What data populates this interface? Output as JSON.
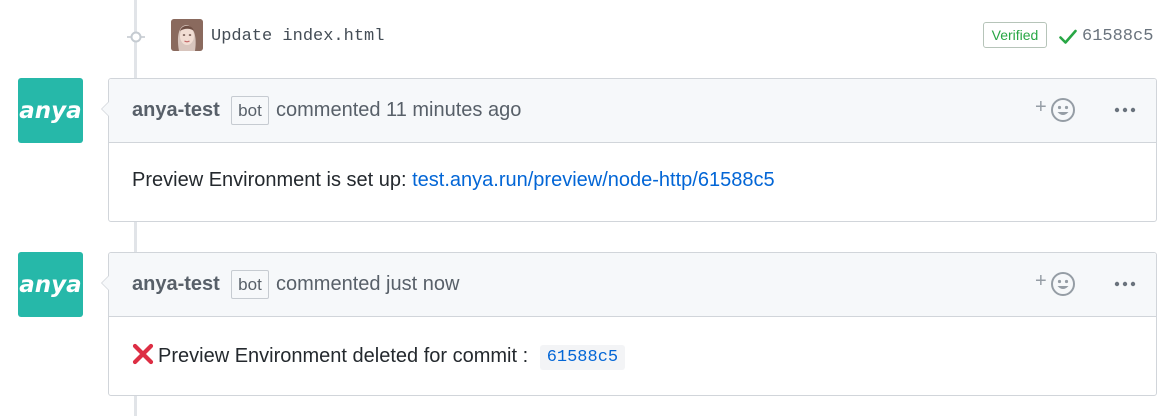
{
  "commit": {
    "message": "Update index.html",
    "verified_label": "Verified",
    "sha": "61588c5",
    "avatar_icon": "user-photo-avatar",
    "check_color": "#28a745"
  },
  "comments": [
    {
      "avatar_text": "anya",
      "author": "anya-test",
      "badge": "bot",
      "time_text": "commented 11 minutes ago",
      "body_prefix": "Preview Environment is set up: ",
      "body_link": "test.anya.run/preview/node-http/61588c5"
    },
    {
      "avatar_text": "anya",
      "author": "anya-test",
      "badge": "bot",
      "time_text": "commented just now",
      "body_prefix": "Preview Environment deleted for commit : ",
      "body_code": "61588c5",
      "body_icon": "cross-mark-icon"
    }
  ],
  "colors": {
    "brand": "#26b8a9",
    "link": "#0366d6",
    "header_bg": "#f6f8fa",
    "border": "#d1d5da"
  }
}
